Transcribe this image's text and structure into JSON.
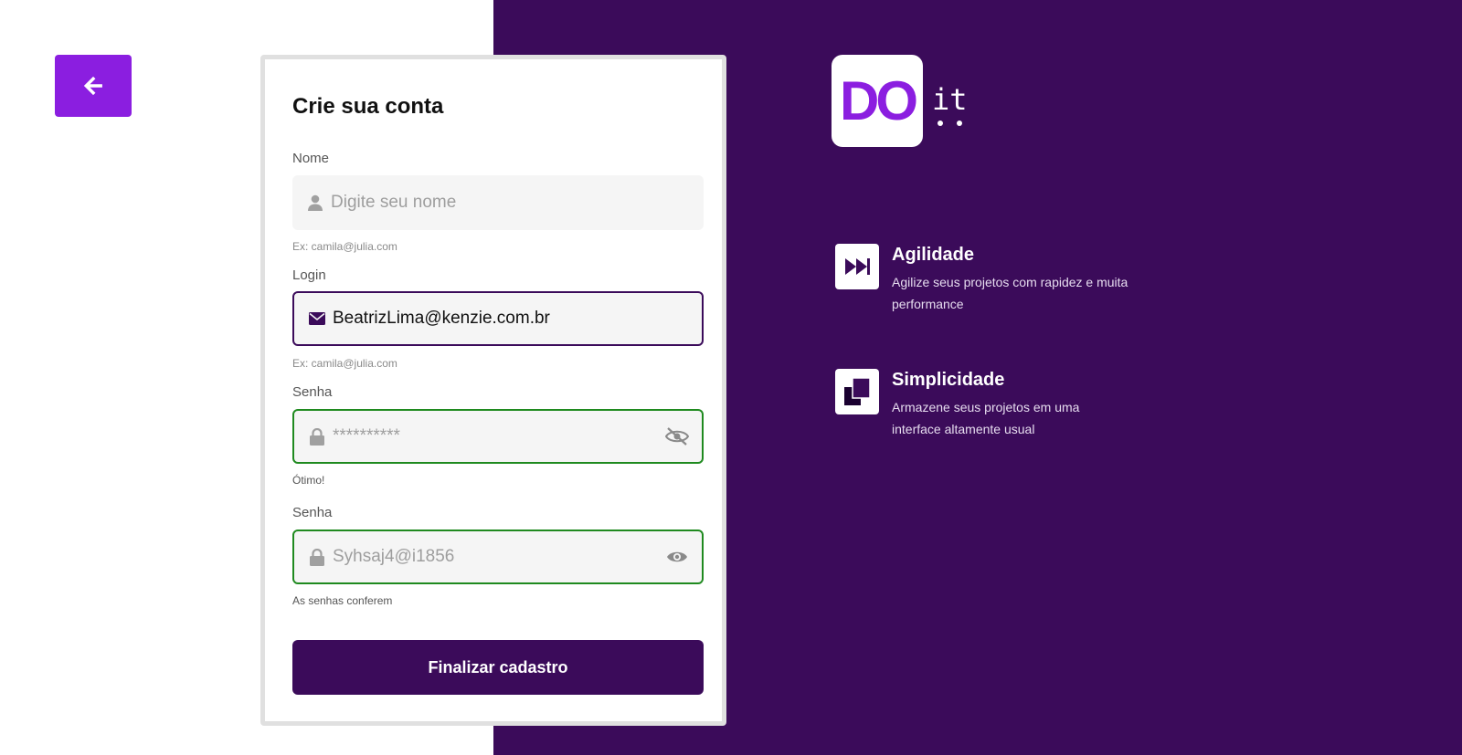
{
  "colors": {
    "primary": "#3b0b5a",
    "accent": "#8b1ee0",
    "success": "#1f8a1f"
  },
  "back": {
    "icon": "arrow-left-icon"
  },
  "form": {
    "title": "Crie sua conta",
    "name": {
      "label": "Nome",
      "placeholder": "Digite seu nome",
      "value": "",
      "hint": "Ex: camila@julia.com",
      "icon": "user-icon"
    },
    "login": {
      "label": "Login",
      "placeholder": "",
      "value": "BeatrizLima@kenzie.com.br",
      "hint": "Ex: camila@julia.com",
      "icon": "mail-icon"
    },
    "password": {
      "label": "Senha",
      "placeholder": "**********",
      "value": "",
      "hint": "Ótimo!",
      "icon": "lock-icon",
      "toggle_icon": "eye-slash-icon"
    },
    "confirm": {
      "label": "Senha",
      "placeholder": "Syhsaj4@i1856",
      "value": "",
      "hint": "As senhas conferem",
      "icon": "lock-icon",
      "toggle_icon": "eye-icon"
    },
    "submit_label": "Finalizar cadastro"
  },
  "brand": {
    "logo_main": "DO",
    "logo_suffix": "it"
  },
  "features": [
    {
      "icon": "fast-forward-icon",
      "title": "Agilidade",
      "description": "Agilize seus projetos com rapidez e muita performance"
    },
    {
      "icon": "stacked-squares-icon",
      "title": "Simplicidade",
      "description": "Armazene seus projetos em uma interface altamente usual"
    }
  ]
}
